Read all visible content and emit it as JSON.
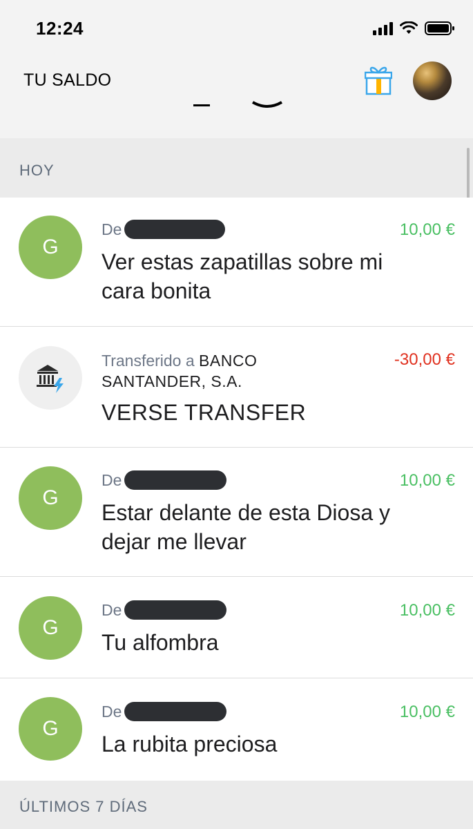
{
  "status": {
    "time": "12:24"
  },
  "header": {
    "title": "TU SALDO",
    "gift_icon": "gift-icon",
    "avatar": "profile-avatar"
  },
  "sections": {
    "today": "HOY",
    "last7": "ÚLTIMOS 7 DÍAS"
  },
  "colors": {
    "avatar_green": "#8fbe5c",
    "positive": "#49bf62",
    "negative": "#e0301e"
  },
  "transactions": [
    {
      "avatar_letter": "G",
      "from_label": "De",
      "amount": "10,00 €",
      "message": "Ver estas zapatillas sobre mi cara bonita",
      "type": "incoming"
    },
    {
      "avatar_icon": "bank-icon",
      "from_label": "Transferido a",
      "recipient": "BANCO SANTANDER, S.A.",
      "amount": "-30,00 €",
      "message": "VERSE TRANSFER",
      "type": "outgoing"
    },
    {
      "avatar_letter": "G",
      "from_label": "De",
      "amount": "10,00 €",
      "message": "Estar delante de esta Diosa y dejar me llevar",
      "type": "incoming"
    },
    {
      "avatar_letter": "G",
      "from_label": "De",
      "amount": "10,00 €",
      "message": "Tu alfombra",
      "type": "incoming"
    },
    {
      "avatar_letter": "G",
      "from_label": "De",
      "amount": "10,00 €",
      "message": "La rubita preciosa",
      "type": "incoming"
    }
  ]
}
